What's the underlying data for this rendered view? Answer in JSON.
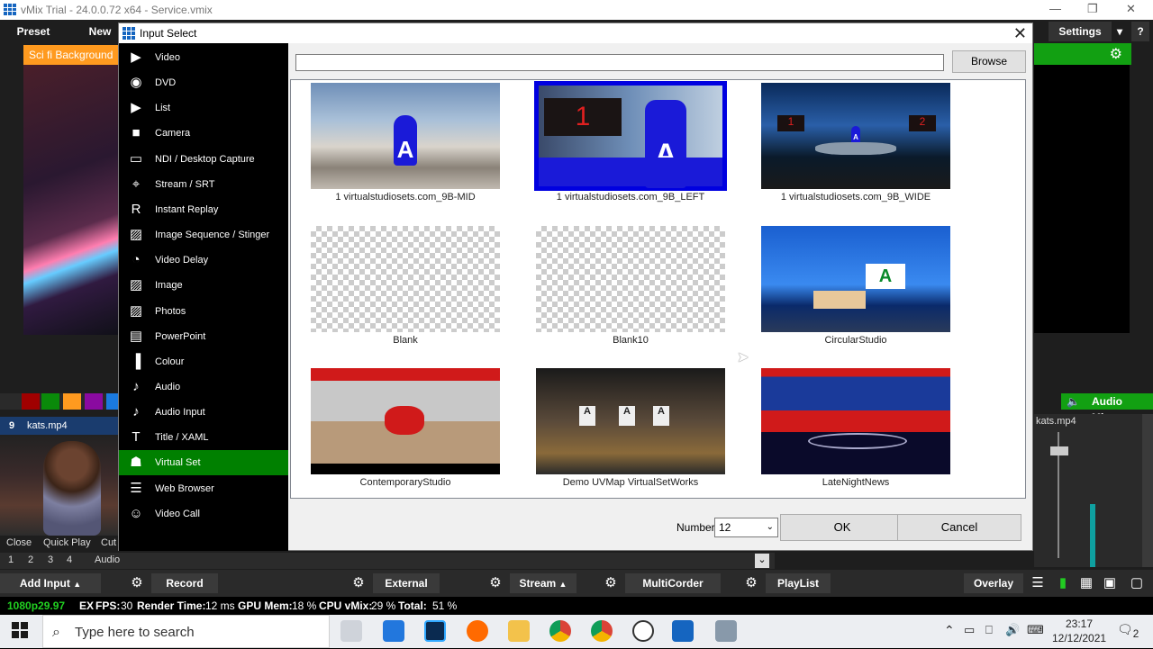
{
  "window": {
    "title": "vMix Trial - 24.0.0.72 x64 - Service.vmix"
  },
  "top": {
    "preset": "Preset",
    "new": "New",
    "settings": "Settings",
    "help": "?"
  },
  "preview": {
    "scifi_label": "Sci fi Background"
  },
  "input": {
    "number": "9",
    "name": "kats.mp4"
  },
  "controls": {
    "close": "Close",
    "quick_play": "Quick Play",
    "cut": "Cut"
  },
  "numrow": {
    "n1": "1",
    "n2": "2",
    "n3": "3",
    "n4": "4",
    "audio": "Audio"
  },
  "audio_mixer": {
    "label": "Audio Mixer",
    "channel": "kats.mp4"
  },
  "bottombar": {
    "add_input": "Add Input",
    "record": "Record",
    "external": "External",
    "stream": "Stream",
    "multicorder": "MultiCorder",
    "playlist": "PlayList",
    "overlay": "Overlay"
  },
  "status": {
    "format": "1080p29.97",
    "ex": "EX",
    "fps_label": "FPS:",
    "fps": "30",
    "render_label": "Render Time:",
    "render": "12 ms",
    "gpu_label": "GPU Mem:",
    "gpu": "18 %",
    "cpu_label": "CPU vMix:",
    "cpu": "29 %",
    "total_label": "Total:",
    "total": "51 %"
  },
  "dialog": {
    "title": "Input Select",
    "categories": [
      {
        "label": "Video",
        "icon": "video-icon"
      },
      {
        "label": "DVD",
        "icon": "disc-icon"
      },
      {
        "label": "List",
        "icon": "list-icon"
      },
      {
        "label": "Camera",
        "icon": "camera-icon"
      },
      {
        "label": "NDI / Desktop Capture",
        "icon": "monitor-icon"
      },
      {
        "label": "Stream / SRT",
        "icon": "antenna-icon"
      },
      {
        "label": "Instant Replay",
        "icon": "replay-icon"
      },
      {
        "label": "Image Sequence / Stinger",
        "icon": "image-sequence-icon"
      },
      {
        "label": "Video Delay",
        "icon": "clock-icon"
      },
      {
        "label": "Image",
        "icon": "image-icon"
      },
      {
        "label": "Photos",
        "icon": "photos-icon"
      },
      {
        "label": "PowerPoint",
        "icon": "presentation-icon"
      },
      {
        "label": "Colour",
        "icon": "colour-icon"
      },
      {
        "label": "Audio",
        "icon": "microphone-icon"
      },
      {
        "label": "Audio Input",
        "icon": "audio-input-icon"
      },
      {
        "label": "Title / XAML",
        "icon": "title-icon"
      },
      {
        "label": "Virtual Set",
        "icon": "virtual-set-icon"
      },
      {
        "label": "Web Browser",
        "icon": "browser-icon"
      },
      {
        "label": "Video Call",
        "icon": "video-call-icon"
      }
    ],
    "selected_category": "Virtual Set",
    "browse": "Browse",
    "search_value": "",
    "items": [
      {
        "name": "1 virtualstudiosets.com_9B-MID"
      },
      {
        "name": "1 virtualstudiosets.com_9B_LEFT"
      },
      {
        "name": "1 virtualstudiosets.com_9B_WIDE"
      },
      {
        "name": "Blank"
      },
      {
        "name": "Blank10"
      },
      {
        "name": "CircularStudio"
      },
      {
        "name": "ContemporaryStudio"
      },
      {
        "name": "Demo UVMap VirtualSetWorks"
      },
      {
        "name": "LateNightNews"
      }
    ],
    "selected_item": "1 virtualstudiosets.com_9B_LEFT",
    "thumb_text": {
      "a": "A",
      "one": "1",
      "two": "2"
    },
    "number_label": "Number",
    "number_value": "12",
    "ok": "OK",
    "cancel": "Cancel"
  },
  "taskbar": {
    "search_placeholder": "Type here to search",
    "time": "23:17",
    "date": "12/12/2021",
    "notifications": "2"
  }
}
